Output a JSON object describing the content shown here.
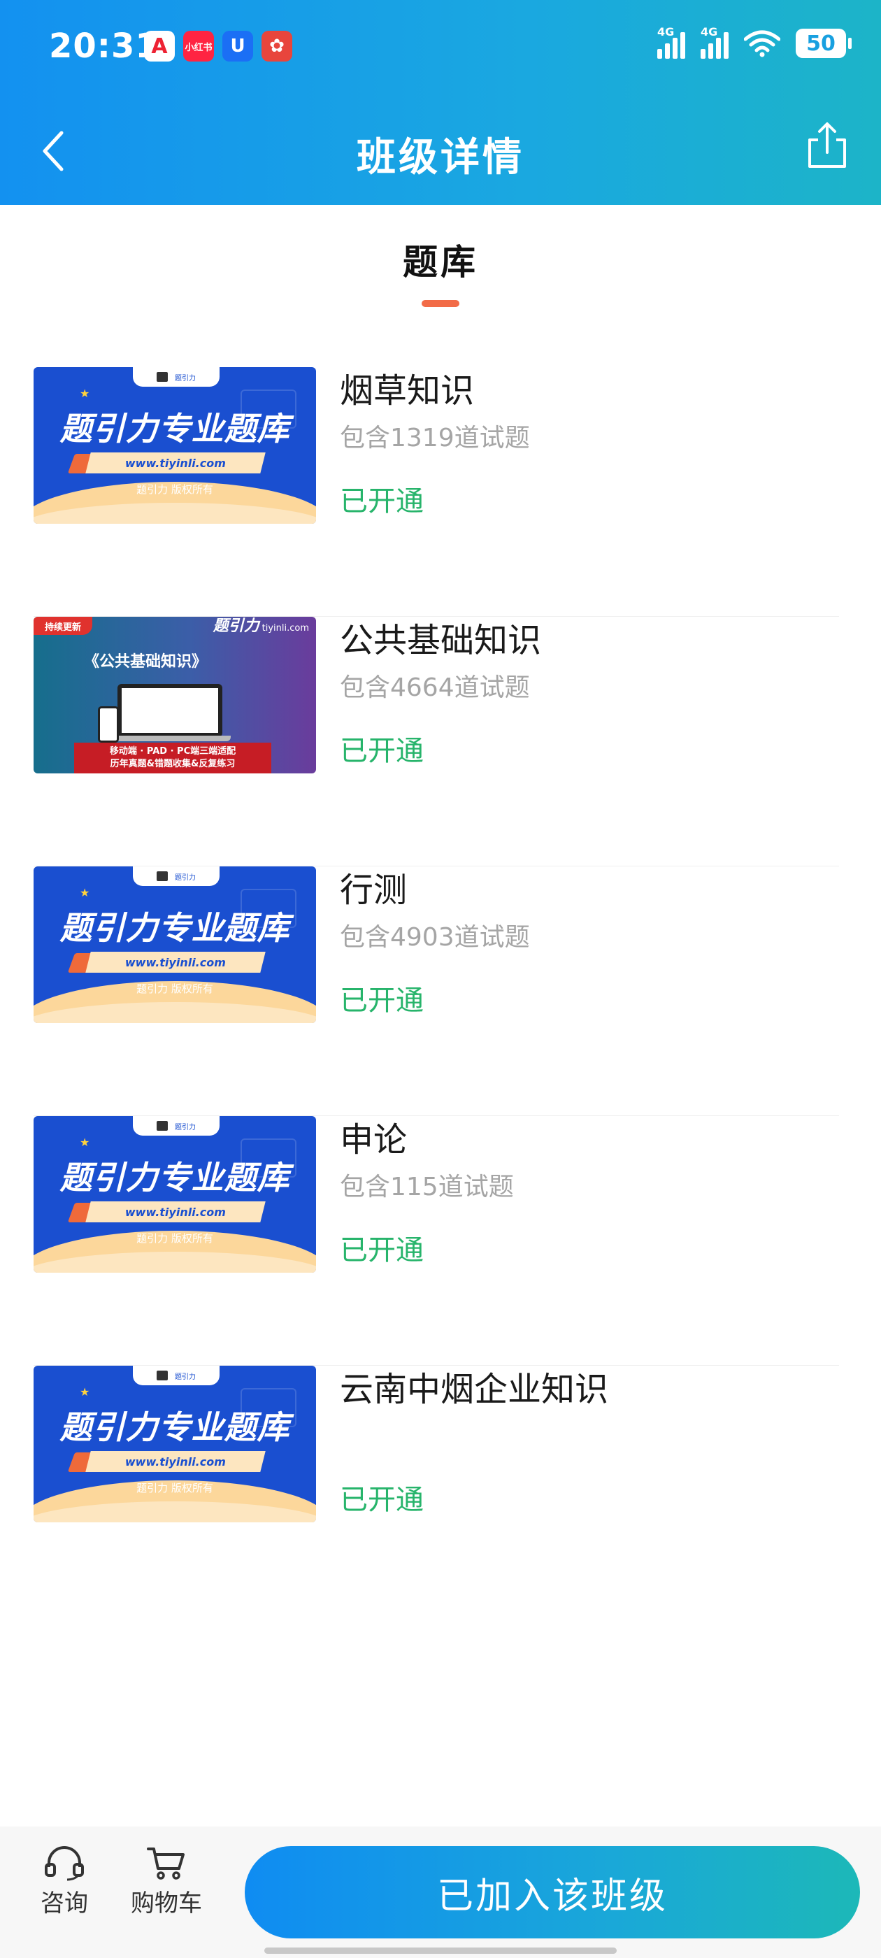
{
  "status_bar": {
    "time": "20:31",
    "apps": [
      {
        "name": "app-a",
        "glyph": "A"
      },
      {
        "name": "xiaohongshu",
        "glyph": "小红书"
      },
      {
        "name": "app-u",
        "glyph": "U"
      },
      {
        "name": "app-flower",
        "glyph": "✿"
      }
    ],
    "signal_1_label": "4G",
    "signal_2_label": "4G",
    "battery": "50"
  },
  "header": {
    "title": "班级详情",
    "back_icon": "chevron-left",
    "share_icon": "share"
  },
  "tab": {
    "label": "题库"
  },
  "banners": {
    "blue": {
      "top_tab": "题引力",
      "main": "题引力专业题库",
      "url": "www.tiyinli.com",
      "footer": "题引力 版权所有"
    },
    "grad": {
      "tag": "持续更新",
      "brand": "题引力",
      "brand_url": "tiyinli.com",
      "heading": "《公共基础知识》",
      "ribbon_line1": "移动端 · PAD · PC端三端适配",
      "ribbon_line2": "历年真题&错题收集&反复练习"
    }
  },
  "items": [
    {
      "title": "烟草知识",
      "count": "包含1319道试题",
      "status": "已开通",
      "thumb": "blue"
    },
    {
      "title": "公共基础知识",
      "count": "包含4664道试题",
      "status": "已开通",
      "thumb": "grad"
    },
    {
      "title": "行测",
      "count": "包含4903道试题",
      "status": "已开通",
      "thumb": "blue"
    },
    {
      "title": "申论",
      "count": "包含115道试题",
      "status": "已开通",
      "thumb": "blue"
    },
    {
      "title": "云南中烟企业知识",
      "count": "",
      "status": "已开通",
      "thumb": "blue"
    }
  ],
  "bottom_bar": {
    "consult_label": "咨询",
    "cart_label": "购物车",
    "join_label": "已加入该班级"
  },
  "colors": {
    "header_start": "#1391f0",
    "header_end": "#1cb4c8",
    "status_green": "#27b46b",
    "tab_underline": "#f26b47",
    "count_gray": "#a5a5a5"
  }
}
